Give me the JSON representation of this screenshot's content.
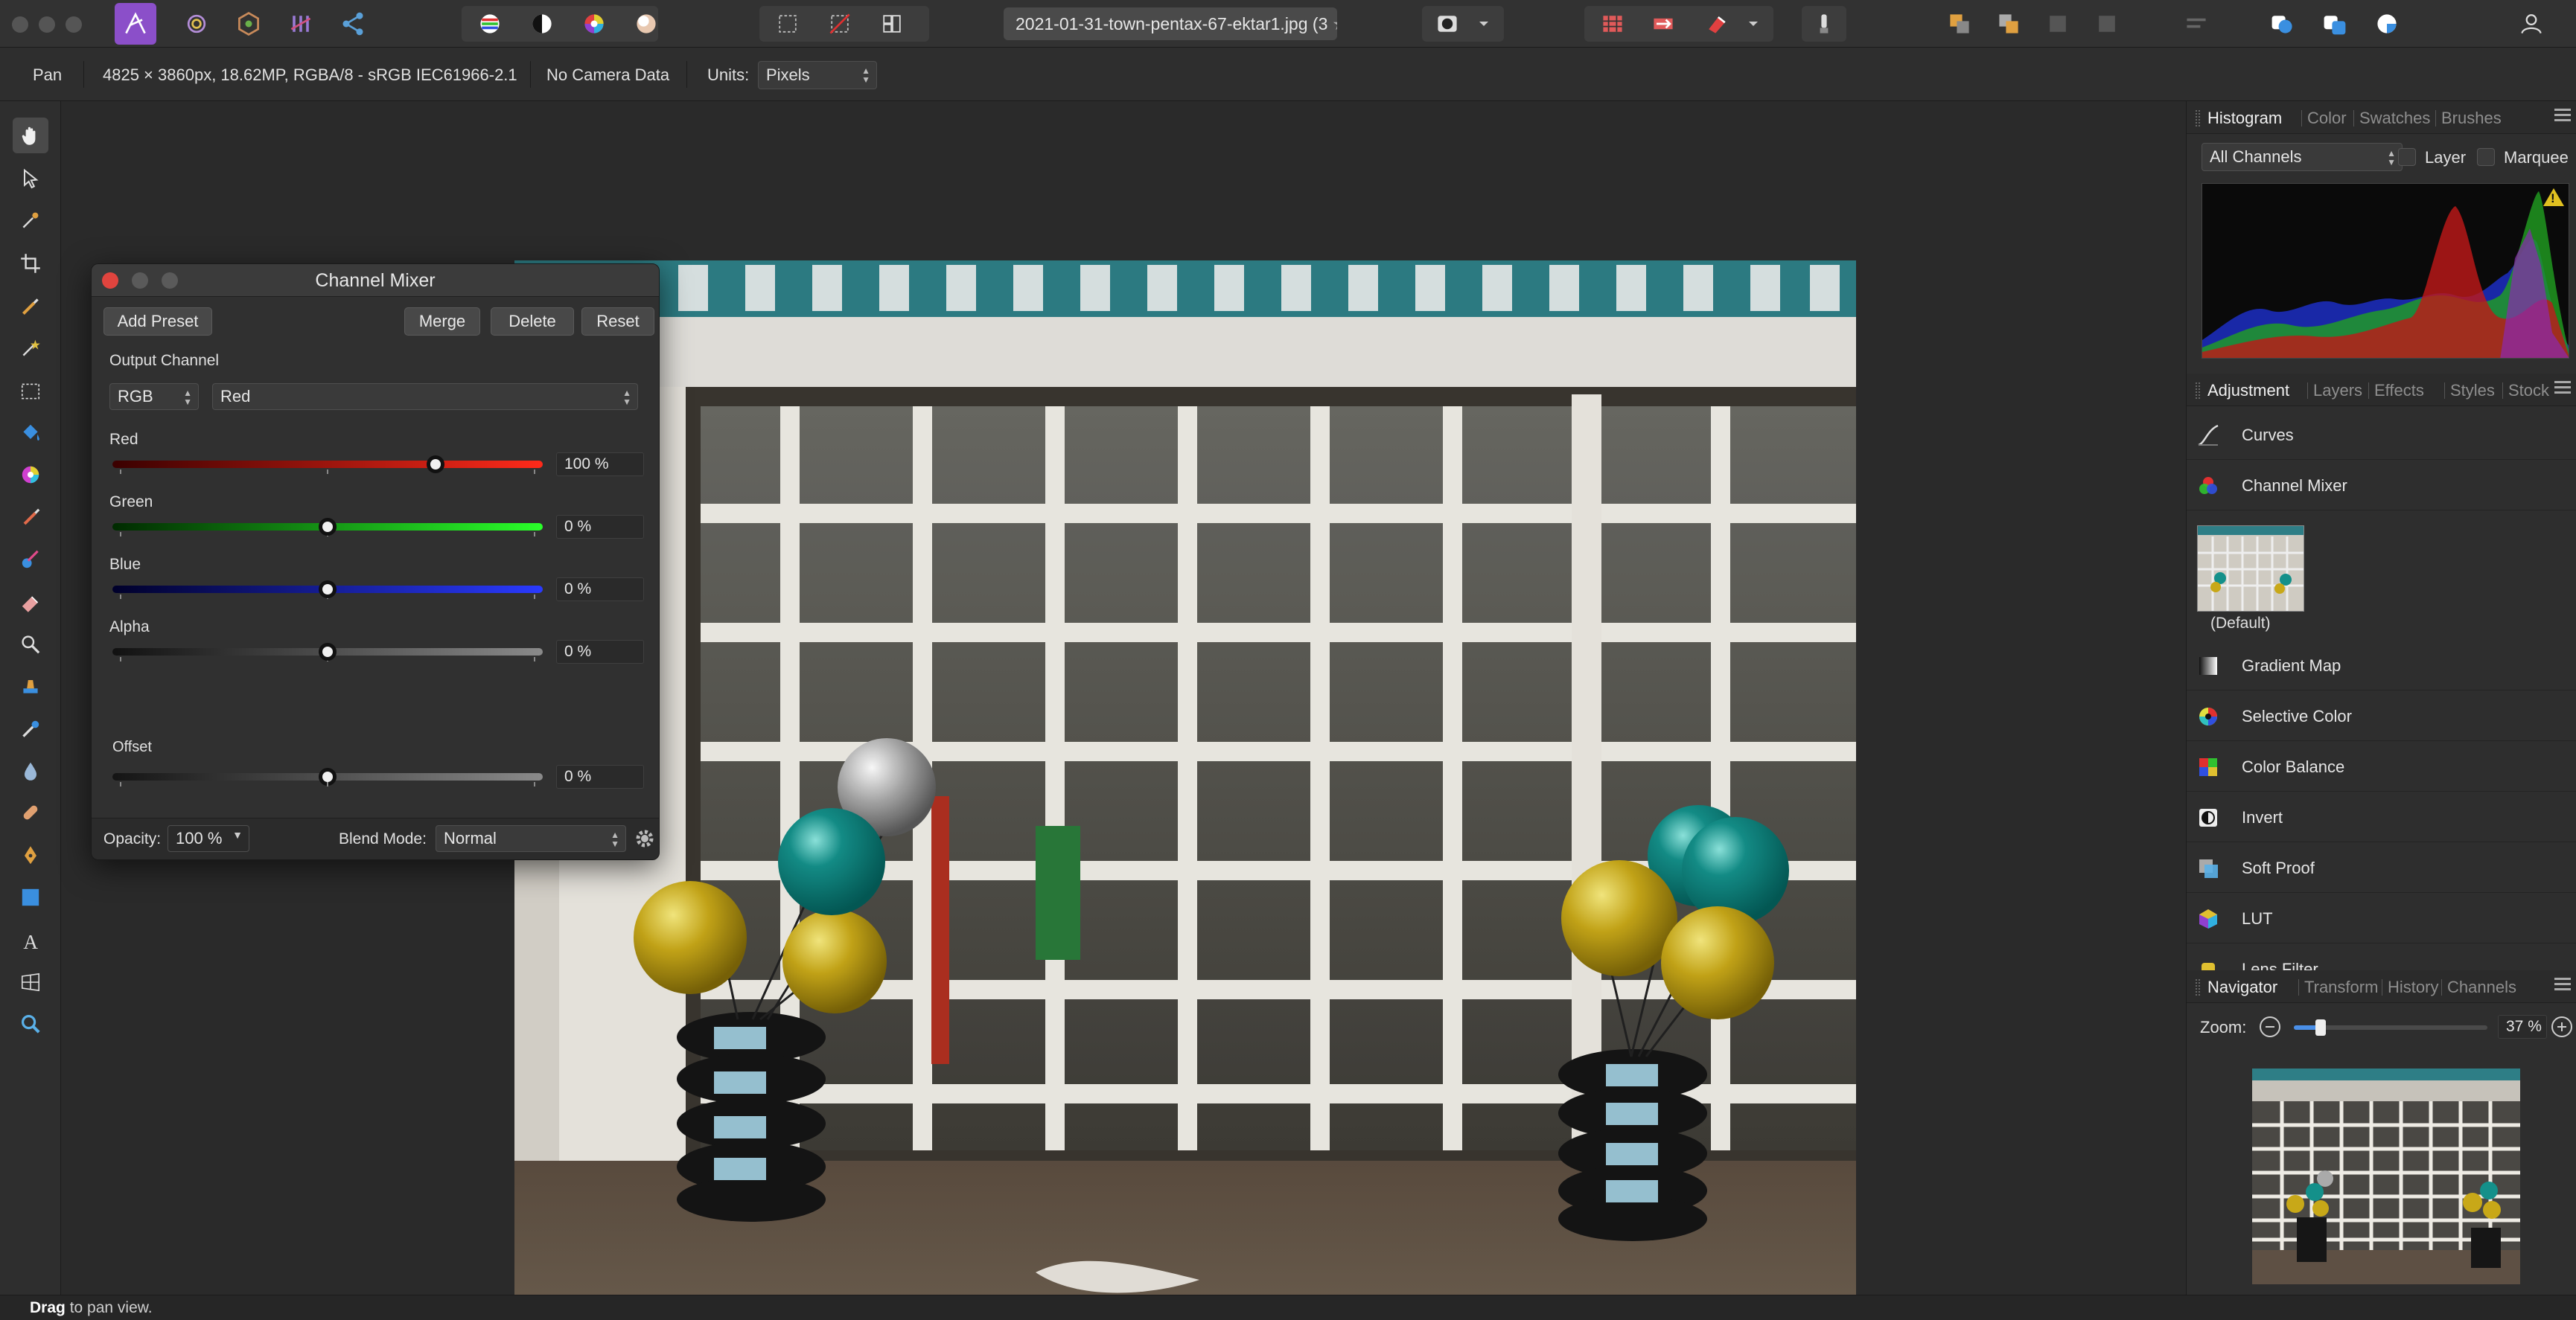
{
  "titlebar": {
    "document_tab": "2021-01-31-town-pentax-67-ektar1.jpg (3",
    "document_tab_close": "★"
  },
  "context": {
    "tool": "Pan",
    "image_info": "4825 × 3860px, 18.62MP, RGBA/8 - sRGB IEC61966-2.1",
    "camera": "No Camera Data",
    "units_label": "Units:",
    "units_value": "Pixels"
  },
  "channel_mixer": {
    "title": "Channel Mixer",
    "buttons": {
      "add_preset": "Add Preset",
      "merge": "Merge",
      "delete": "Delete",
      "reset": "Reset"
    },
    "output_channel_label": "Output Channel",
    "output_mode": "RGB",
    "output_channel": "Red",
    "sliders": [
      {
        "label": "Red",
        "value": "100 %",
        "fraction": 0.75,
        "color_from": "#3a0000",
        "color_to": "#ff2a1a"
      },
      {
        "label": "Green",
        "value": "0 %",
        "fraction": 0.5,
        "color_from": "#002a00",
        "color_to": "#2aff2a"
      },
      {
        "label": "Blue",
        "value": "0 %",
        "fraction": 0.5,
        "color_from": "#00002a",
        "color_to": "#2a3aff"
      },
      {
        "label": "Alpha",
        "value": "0 %",
        "fraction": 0.5,
        "color_from": "#111111",
        "color_to": "#8a8a8a"
      }
    ],
    "offset": {
      "label": "Offset",
      "value": "0 %",
      "fraction": 0.5
    },
    "opacity_label": "Opacity:",
    "opacity_value": "100 %",
    "blend_label": "Blend Mode:",
    "blend_value": "Normal"
  },
  "histogram_panel": {
    "tabs": [
      "Histogram",
      "Color",
      "Swatches",
      "Brushes"
    ],
    "channels": "All Channels",
    "layer_label": "Layer",
    "marquee_label": "Marquee",
    "warning": "!"
  },
  "adjustment_panel": {
    "tabs": [
      "Adjustment",
      "Layers",
      "Effects",
      "Styles",
      "Stock"
    ],
    "items_top": [
      {
        "label": "Curves"
      },
      {
        "label": "Channel Mixer"
      }
    ],
    "preset_label": "(Default)",
    "items_bottom": [
      {
        "label": "Gradient Map"
      },
      {
        "label": "Selective Color"
      },
      {
        "label": "Color Balance"
      },
      {
        "label": "Invert"
      },
      {
        "label": "Soft Proof"
      },
      {
        "label": "LUT"
      },
      {
        "label": "Lens Filter"
      }
    ]
  },
  "navigator_panel": {
    "tabs": [
      "Navigator",
      "Transform",
      "History",
      "Channels"
    ],
    "zoom_label": "Zoom:",
    "zoom_value": "37 %",
    "zoom_fraction": 0.14
  },
  "statusbar": {
    "bold": "Drag",
    "text": " to pan view."
  },
  "colors": {
    "accent": "#4a8fe7",
    "app_bg": "#2a2a2a",
    "panel_bg": "#2e2e2e"
  }
}
